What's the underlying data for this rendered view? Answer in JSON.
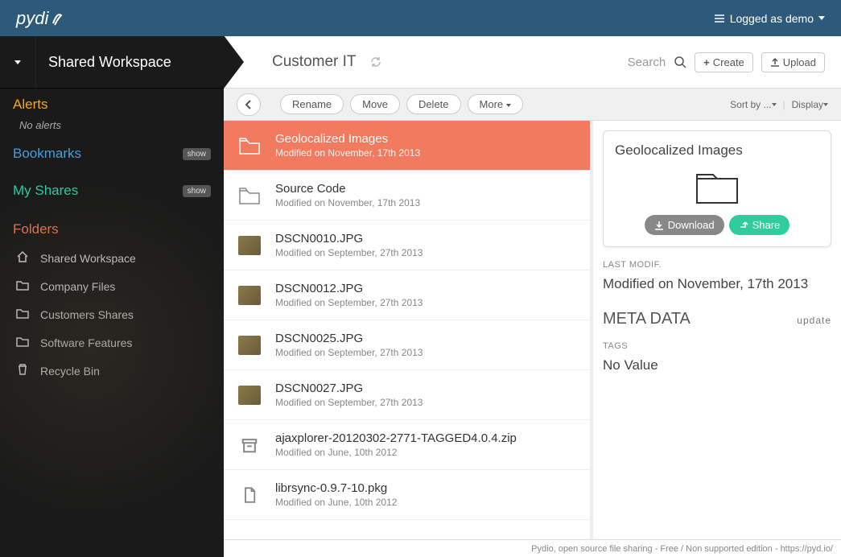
{
  "header": {
    "logo": "pydi",
    "user_text": "Logged as demo"
  },
  "sidebar": {
    "workspace": "Shared Workspace",
    "alerts_label": "Alerts",
    "alerts_empty": "No alerts",
    "bookmarks_label": "Bookmarks",
    "show_label": "show",
    "shares_label": "My Shares",
    "folders_label": "Folders",
    "folders": [
      {
        "name": "Shared Workspace",
        "icon": "home"
      },
      {
        "name": "Company Files",
        "icon": "folder"
      },
      {
        "name": "Customers Shares",
        "icon": "folder"
      },
      {
        "name": "Software Features",
        "icon": "folder"
      },
      {
        "name": "Recycle Bin",
        "icon": "trash"
      }
    ]
  },
  "breadcrumb": {
    "current": "Customer IT",
    "search_label": "Search",
    "create_label": "Create",
    "upload_label": "Upload"
  },
  "toolbar": {
    "rename": "Rename",
    "move": "Move",
    "delete": "Delete",
    "more": "More",
    "sort_by": "Sort by ...",
    "display": "Display"
  },
  "files": [
    {
      "name": "Geolocalized Images",
      "meta": "Modified on November, 17th 2013",
      "type": "folder",
      "selected": true
    },
    {
      "name": "Source Code",
      "meta": "Modified on November, 17th 2013",
      "type": "folder"
    },
    {
      "name": "DSCN0010.JPG",
      "meta": "Modified on September, 27th 2013",
      "type": "image"
    },
    {
      "name": "DSCN0012.JPG",
      "meta": "Modified on September, 27th 2013",
      "type": "image"
    },
    {
      "name": "DSCN0025.JPG",
      "meta": "Modified on September, 27th 2013",
      "type": "image"
    },
    {
      "name": "DSCN0027.JPG",
      "meta": "Modified on September, 27th 2013",
      "type": "image"
    },
    {
      "name": "ajaxplorer-20120302-2771-TAGGED4.0.4.zip",
      "meta": "Modified on June, 10th 2012",
      "type": "archive"
    },
    {
      "name": "librsync-0.9.7-10.pkg",
      "meta": "Modified on June, 10th 2012",
      "type": "file"
    }
  ],
  "detail": {
    "title": "Geolocalized Images",
    "download": "Download",
    "share": "Share",
    "last_modif_label": "LAST MODIF.",
    "last_modif_value": "Modified on November, 17th 2013",
    "meta_header": "META DATA",
    "update": "update",
    "tags_label": "TAGS",
    "tags_value": "No Value"
  },
  "footer": "Pydio, open source file sharing - Free / Non supported edition - https://pyd.io/"
}
